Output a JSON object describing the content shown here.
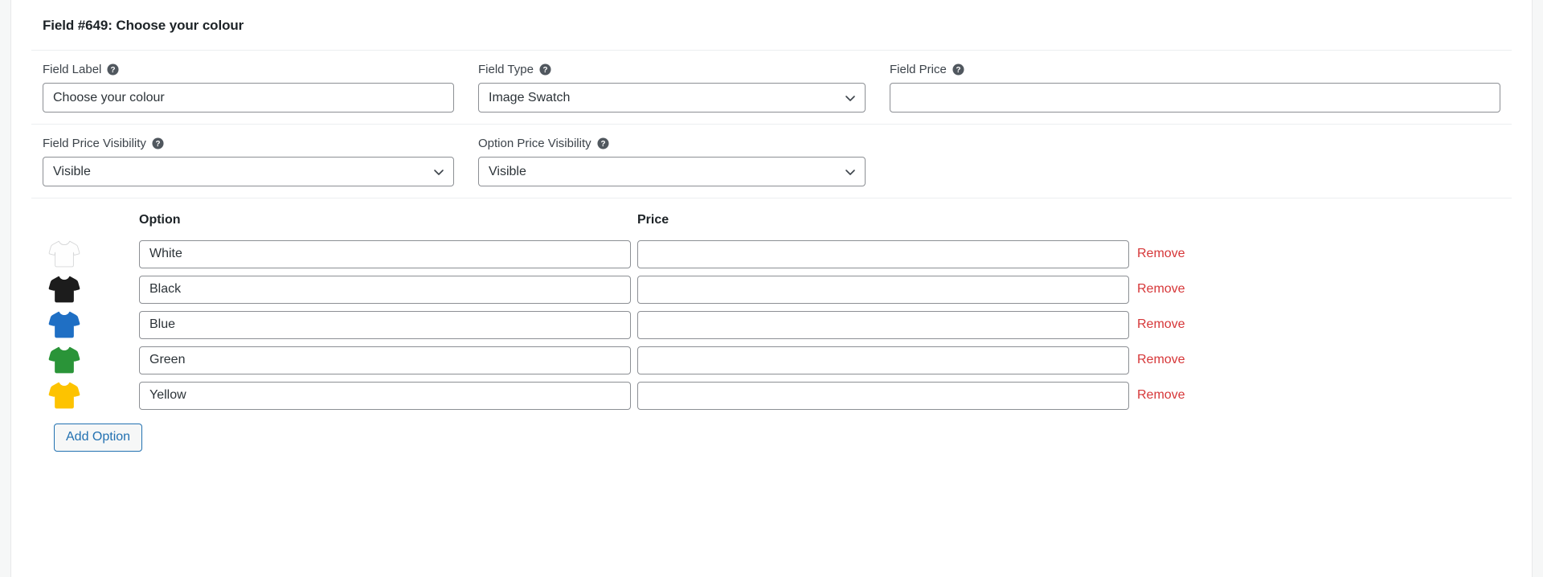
{
  "panel": {
    "title": "Field #649: Choose your colour"
  },
  "fields": {
    "field_label": {
      "label": "Field Label",
      "help_icon": "help-circle-icon",
      "value": "Choose your colour",
      "placeholder": ""
    },
    "field_type": {
      "label": "Field Type",
      "help_icon": "help-circle-icon",
      "value": "Image Swatch",
      "options": [
        "Image Swatch"
      ],
      "caret_icon": "chevron-down-icon"
    },
    "field_price": {
      "label": "Field Price",
      "help_icon": "help-circle-icon",
      "value": "",
      "placeholder": ""
    },
    "field_price_visibility": {
      "label": "Field Price Visibility",
      "help_icon": "help-circle-icon",
      "value": "Visible",
      "options": [
        "Visible"
      ],
      "caret_icon": "chevron-down-icon"
    },
    "option_price_visibility": {
      "label": "Option Price Visibility",
      "help_icon": "help-circle-icon",
      "value": "Visible",
      "options": [
        "Visible"
      ],
      "caret_icon": "chevron-down-icon"
    }
  },
  "options_table": {
    "headers": {
      "option": "Option",
      "price": "Price"
    },
    "remove_label": "Remove",
    "rows": [
      {
        "swatch_icon": "tshirt-icon",
        "swatch_color": "#fefefe",
        "swatch_stroke": "#d6d7d8",
        "name": "White",
        "price": ""
      },
      {
        "swatch_icon": "tshirt-icon",
        "swatch_color": "#1c1c1c",
        "swatch_stroke": "#1c1c1c",
        "name": "Black",
        "price": ""
      },
      {
        "swatch_icon": "tshirt-icon",
        "swatch_color": "#1f6fc4",
        "swatch_stroke": "#1f6fc4",
        "name": "Blue",
        "price": ""
      },
      {
        "swatch_icon": "tshirt-icon",
        "swatch_color": "#2a9438",
        "swatch_stroke": "#2a9438",
        "name": "Green",
        "price": ""
      },
      {
        "swatch_icon": "tshirt-icon",
        "swatch_color": "#fdc300",
        "swatch_stroke": "#fdc300",
        "name": "Yellow",
        "price": ""
      }
    ]
  },
  "buttons": {
    "add_option": "Add Option"
  },
  "colors": {
    "link_red": "#d63638",
    "link_blue": "#2271b1",
    "text_dark": "#1d2327",
    "border": "#8c8f94"
  }
}
